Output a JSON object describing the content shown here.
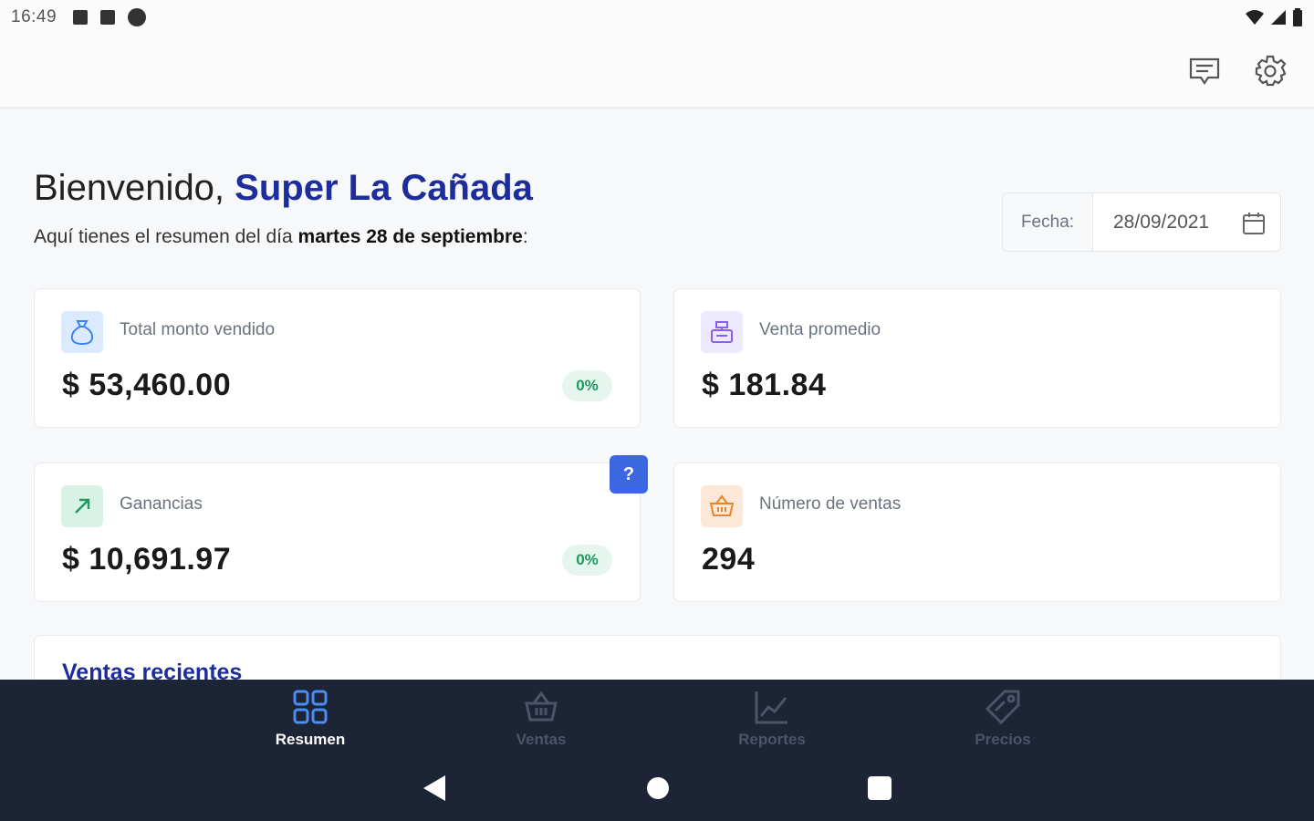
{
  "status_bar": {
    "time": "16:49"
  },
  "header": {
    "feedback_icon": "message-icon",
    "settings_icon": "gear-icon"
  },
  "greeting": {
    "prefix": "Bienvenido, ",
    "store_name": "Super La Cañada",
    "subtitle_prefix": "Aquí tienes el resumen del día ",
    "subtitle_date": "martes 28 de septiembre",
    "subtitle_suffix": ":"
  },
  "date_filter": {
    "label": "Fecha:",
    "value": "28/09/2021"
  },
  "cards": {
    "total": {
      "title": "Total monto vendido",
      "value": "$ 53,460.00",
      "badge": "0%"
    },
    "average": {
      "title": "Venta promedio",
      "value": "$ 181.84"
    },
    "profit": {
      "title": "Ganancias",
      "value": "$ 10,691.97",
      "badge": "0%",
      "help": "?"
    },
    "count": {
      "title": "Número de ventas",
      "value": "294"
    }
  },
  "recent": {
    "title": "Ventas recientes"
  },
  "bottom_nav": {
    "items": [
      {
        "label": "Resumen",
        "icon": "dashboard-icon",
        "active": true
      },
      {
        "label": "Ventas",
        "icon": "basket-icon",
        "active": false
      },
      {
        "label": "Reportes",
        "icon": "chart-icon",
        "active": false
      },
      {
        "label": "Precios",
        "icon": "tag-icon",
        "active": false
      }
    ]
  },
  "colors": {
    "brand": "#1d2d9c",
    "nav_bg": "#1c2436",
    "positive": "#1d9a5d",
    "help": "#3d67e0"
  }
}
